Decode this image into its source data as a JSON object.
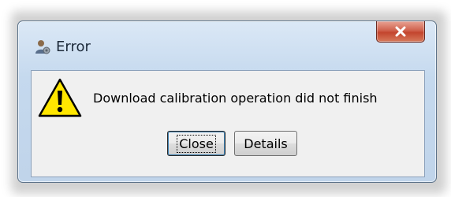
{
  "dialog": {
    "title": "Error",
    "app_icon": "user-gear-icon",
    "close_icon": "close-x-icon",
    "warning_icon": "warning-triangle-icon",
    "message": "Download calibration operation did not finish",
    "buttons": {
      "close_label": "Close",
      "details_label": "Details"
    }
  },
  "colors": {
    "titlebar": "#c5d9ee",
    "close_button": "#c3452e",
    "content_background": "#f0f0f0",
    "warning_fill": "#ffe600"
  }
}
